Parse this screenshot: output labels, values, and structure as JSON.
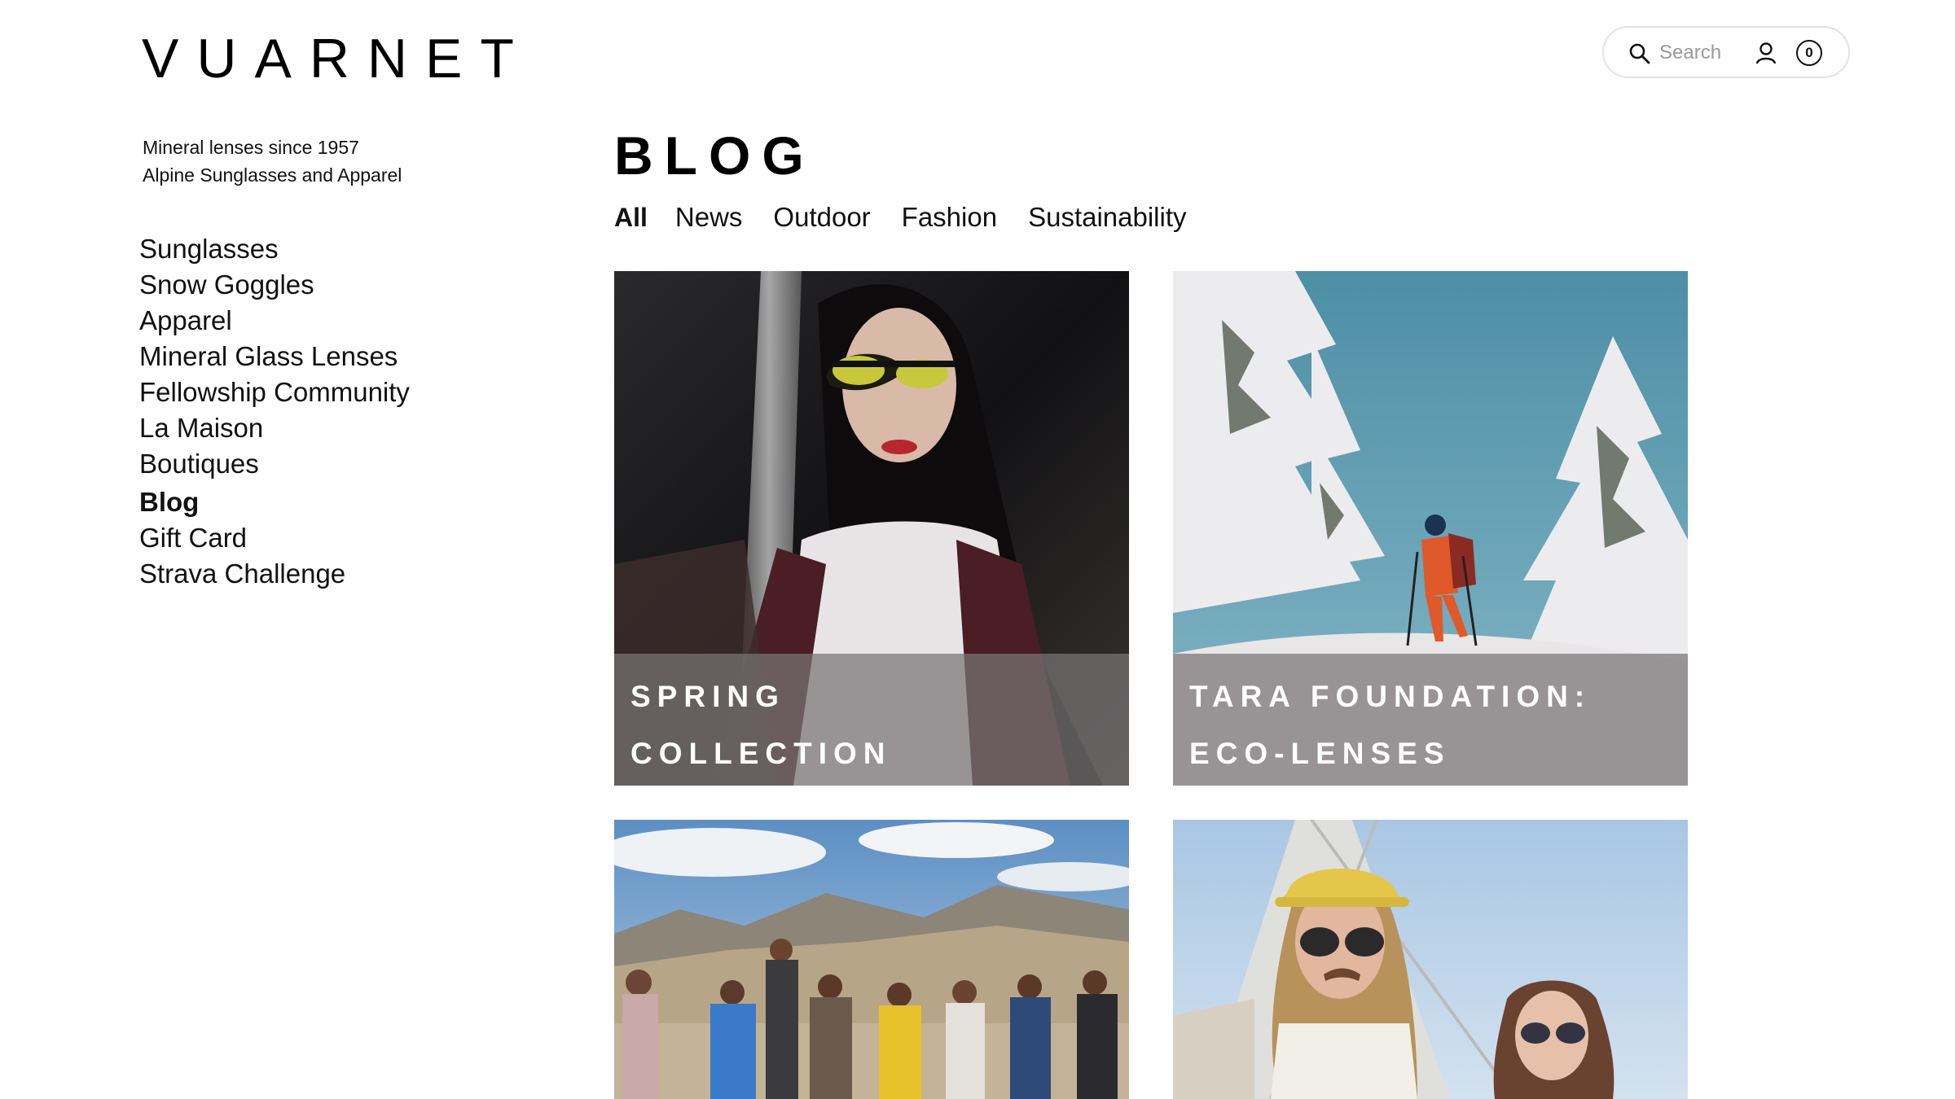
{
  "brand": {
    "logo_text": "VUARNET"
  },
  "header": {
    "search_placeholder": "Search",
    "cart_count": "0",
    "icons": [
      "search-icon",
      "account-icon",
      "cart-icon"
    ]
  },
  "tagline": {
    "line1": "Mineral lenses since 1957",
    "line2": "Alpine Sunglasses and Apparel"
  },
  "sidebar": {
    "items": [
      {
        "label": "Sunglasses",
        "active": false
      },
      {
        "label": "Snow Goggles",
        "active": false
      },
      {
        "label": "Apparel",
        "active": false
      },
      {
        "label": "Mineral Glass Lenses",
        "active": false
      },
      {
        "label": "Fellowship Community",
        "active": false
      },
      {
        "label": "La Maison",
        "active": false
      },
      {
        "label": "Boutiques",
        "active": false
      },
      {
        "label": "Blog",
        "active": true
      },
      {
        "label": "Gift Card",
        "active": false
      },
      {
        "label": "Strava Challenge",
        "active": false
      }
    ]
  },
  "main": {
    "title": "BLOG",
    "tabs": [
      {
        "label": "All",
        "active": true
      },
      {
        "label": "News",
        "active": false
      },
      {
        "label": "Outdoor",
        "active": false
      },
      {
        "label": "Fashion",
        "active": false
      },
      {
        "label": "Sustainability",
        "active": false
      }
    ],
    "cards": [
      {
        "title_line1": "SPRING",
        "title_line2": "COLLECTION"
      },
      {
        "title_line1": "TARA FOUNDATION:",
        "title_line2": "ECO-LENSES"
      },
      {
        "title_line1": "",
        "title_line2": ""
      },
      {
        "title_line1": "",
        "title_line2": ""
      }
    ]
  },
  "colors": {
    "text": "#111111",
    "background": "#ffffff",
    "overlay": "#787476",
    "pill_border": "#e3e3e3"
  }
}
